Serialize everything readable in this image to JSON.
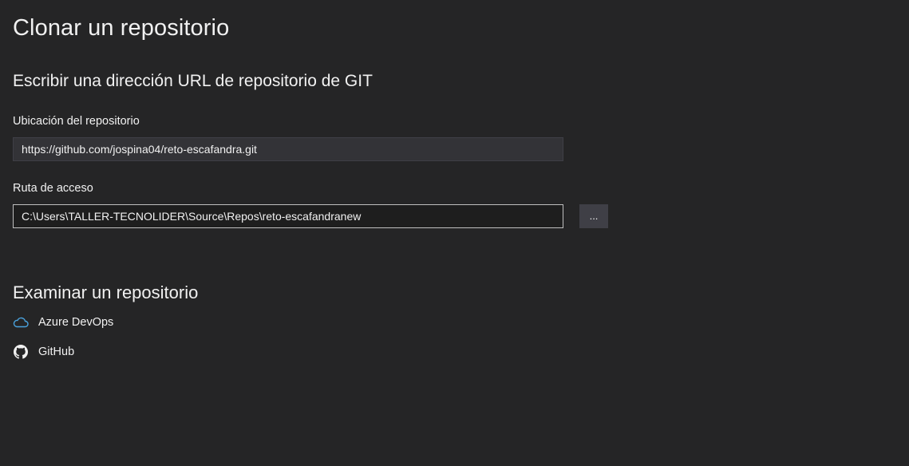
{
  "page": {
    "title": "Clonar un repositorio"
  },
  "clone_url_section": {
    "title": "Escribir una dirección URL de repositorio de GIT",
    "location_label": "Ubicación del repositorio",
    "location_value": "https://github.com/jospina04/reto-escafandra.git",
    "path_label": "Ruta de acceso",
    "path_value": "C:\\Users\\TALLER-TECNOLIDER\\Source\\Repos\\reto-escafandranew",
    "browse_button_label": "..."
  },
  "browse_section": {
    "title": "Examinar un repositorio",
    "providers": [
      {
        "label": "Azure DevOps",
        "icon": "cloud-icon",
        "icon_color": "#4aa3df"
      },
      {
        "label": "GitHub",
        "icon": "github-icon",
        "icon_color": "#f1f1f1"
      }
    ]
  },
  "colors": {
    "background": "#252526",
    "text": "#f1f1f1",
    "input_background": "#333337",
    "focused_input_border": "#bfbfbf"
  }
}
